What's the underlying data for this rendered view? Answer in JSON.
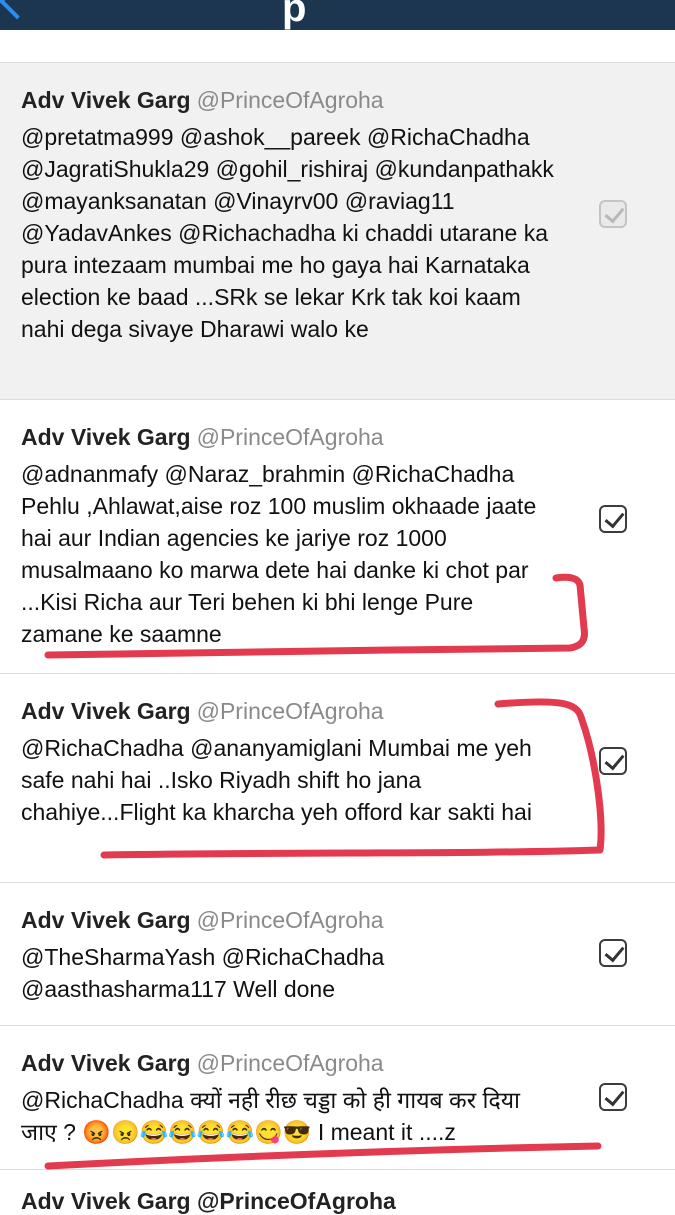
{
  "colors": {
    "nav_bar": "#1d3650",
    "accent": "#2a8ef2",
    "annotation": "#e23a4f",
    "selected_row": "#f1f1f1"
  },
  "icons": {
    "back": "chevron-left-icon",
    "select": "checkmark-checkbox-icon"
  },
  "tweets": [
    {
      "name": "Adv Vivek Garg",
      "handle": "@PrinceOfAgroha",
      "text": "@pretatma999 @ashok__pareek @RichaChadha @JagratiShukla29 @gohil_rishiraj @kundanpathakk @mayanksanatan @Vinayrv00 @raviag11 @YadavAnkes @Richachadha ki chaddi utarane ka pura intezaam mumbai me ho gaya hai Karnataka election ke baad ...SRk se lekar Krk tak koi kaam nahi dega sivaye Dharawi walo ke",
      "checked": true,
      "disabled": true
    },
    {
      "name": "Adv Vivek Garg",
      "handle": "@PrinceOfAgroha",
      "text": "@adnanmafy @Naraz_brahmin @RichaChadha Pehlu ,Ahlawat,aise roz 100 muslim okhaade jaate hai aur Indian agencies ke jariye roz 1000 musalmaano ko marwa dete hai danke ki chot par ...Kisi Richa aur Teri behen ki bhi lenge Pure zamane ke saamne",
      "checked": true,
      "disabled": false
    },
    {
      "name": "Adv Vivek Garg",
      "handle": "@PrinceOfAgroha",
      "text": "@RichaChadha @ananyamiglani Mumbai me yeh safe nahi hai ..Isko Riyadh shift ho jana chahiye...Flight ka kharcha yeh offord kar sakti hai",
      "checked": true,
      "disabled": false
    },
    {
      "name": "Adv Vivek Garg",
      "handle": "@PrinceOfAgroha",
      "text": "@TheSharmaYash @RichaChadha @aasthasharma117 Well done",
      "checked": true,
      "disabled": false
    },
    {
      "name": "Adv Vivek Garg",
      "handle": "@PrinceOfAgroha",
      "text_a": "@RichaChadha क्यों नही रीछ चड्डा को ही गायब कर दिया जाए ?",
      "emojis": "😡😠😂😂😂😂😋😎",
      "text_b": "I meant it ....z",
      "checked": true,
      "disabled": false
    }
  ],
  "partial_next": "Adv Vivek Garg @PrinceOfAgroha"
}
